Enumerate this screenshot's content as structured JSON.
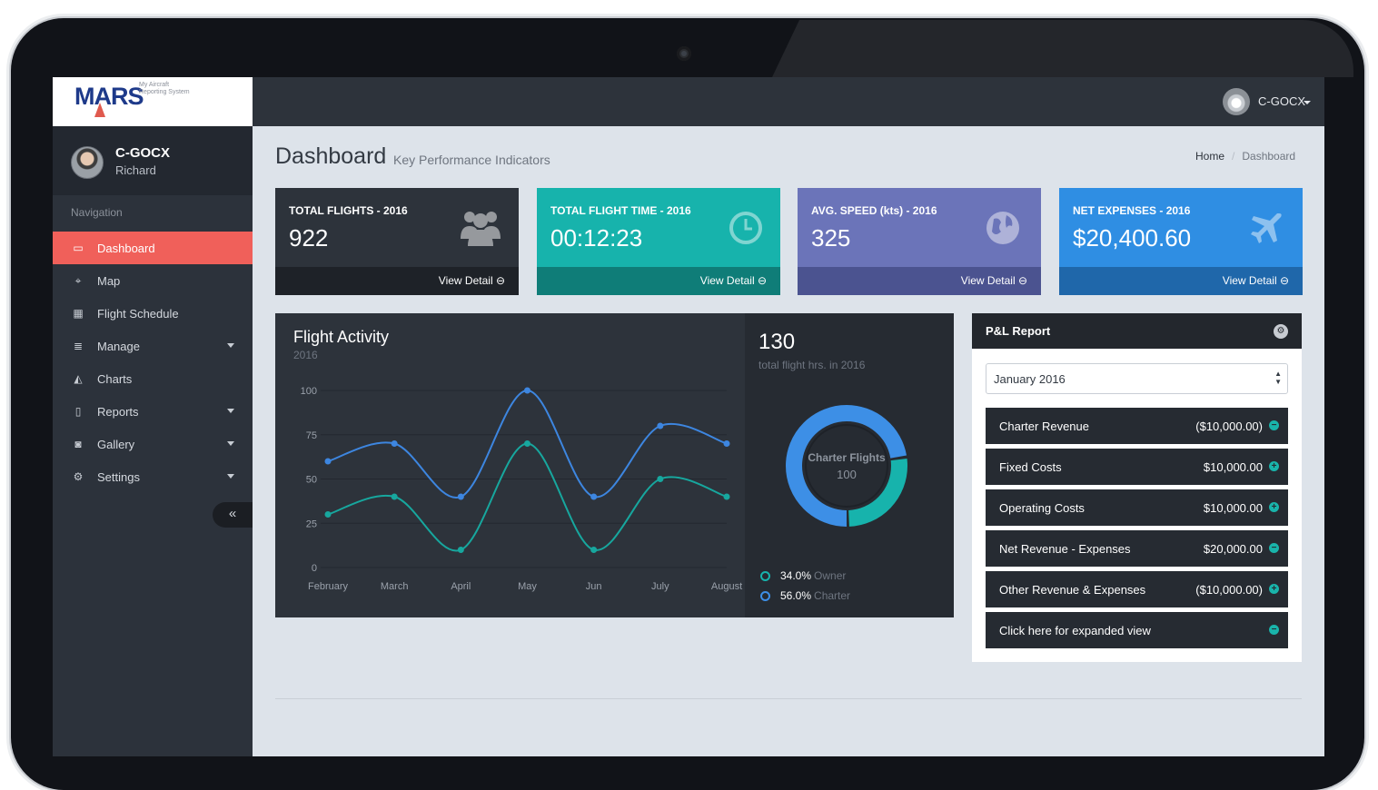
{
  "brand": {
    "logo_text": "MARS",
    "logo_tagline": "My Aircraft Reporting System"
  },
  "user": {
    "name": "C-GOCX",
    "subtitle": "Richard"
  },
  "topbar": {
    "user_label": "C-GOCX"
  },
  "sidebar": {
    "header": "Navigation",
    "items": [
      {
        "label": "Dashboard",
        "icon": "laptop-icon",
        "active": true,
        "has_caret": false
      },
      {
        "label": "Map",
        "icon": "map-marker-icon",
        "active": false,
        "has_caret": false
      },
      {
        "label": "Flight Schedule",
        "icon": "calendar-icon",
        "active": false,
        "has_caret": false
      },
      {
        "label": "Manage",
        "icon": "database-icon",
        "active": false,
        "has_caret": true
      },
      {
        "label": "Charts",
        "icon": "area-chart-icon",
        "active": false,
        "has_caret": false
      },
      {
        "label": "Reports",
        "icon": "file-icon",
        "active": false,
        "has_caret": true
      },
      {
        "label": "Gallery",
        "icon": "camera-icon",
        "active": false,
        "has_caret": true
      },
      {
        "label": "Settings",
        "icon": "gears-icon",
        "active": false,
        "has_caret": true
      }
    ],
    "collapse_label": "«"
  },
  "header": {
    "title": "Dashboard",
    "subtitle": "Key Performance Indicators"
  },
  "breadcrumb": {
    "home": "Home",
    "separator": "/",
    "current": "Dashboard"
  },
  "stats": [
    {
      "label": "TOTAL FLIGHTS - 2016",
      "value": "922",
      "link": "View Detail",
      "icon": "users-icon"
    },
    {
      "label": "TOTAL FLIGHT TIME - 2016",
      "value": "00:12:23",
      "link": "View Detail",
      "icon": "clock-icon"
    },
    {
      "label": "AVG. SPEED (kts) - 2016",
      "value": "325",
      "link": "View Detail",
      "icon": "globe-icon"
    },
    {
      "label": "NET EXPENSES - 2016",
      "value": "$20,400.60",
      "link": "View Detail",
      "icon": "plane-icon"
    }
  ],
  "activity": {
    "title": "Flight Activity",
    "year": "2016",
    "total": "130",
    "total_label": "total flight hrs. in 2016",
    "donut_label": "Charter Flights",
    "donut_value": "100",
    "legend": [
      {
        "pct": "34.0%",
        "name": "Owner",
        "color": "#17b3ac"
      },
      {
        "pct": "56.0%",
        "name": "Charter",
        "color": "#3d8fe6"
      }
    ]
  },
  "chart_data": [
    {
      "type": "line",
      "title": "Flight Activity",
      "subtitle": "2016",
      "categories": [
        "February",
        "March",
        "April",
        "May",
        "Jun",
        "July",
        "August"
      ],
      "y_ticks": [
        "0",
        "25",
        "50",
        "75",
        "100"
      ],
      "ylim": [
        0,
        100
      ],
      "grid": true,
      "series": [
        {
          "values": [
            60,
            70,
            40,
            100,
            40,
            80,
            70
          ],
          "color": "#3d86e0"
        },
        {
          "values": [
            30,
            40,
            10,
            70,
            10,
            50,
            40
          ],
          "color": "#17a79e"
        }
      ]
    },
    {
      "type": "pie",
      "title": "Charter Flights",
      "center_value": "100",
      "slices": [
        {
          "value": 73,
          "color": "#3d8fe6"
        },
        {
          "value": 27,
          "color": "#17b3ac"
        }
      ]
    }
  ],
  "pl": {
    "title": "P&L Report",
    "selected_month": "January 2016",
    "rows": [
      {
        "name": "Charter Revenue",
        "amount": "($10,000.00)",
        "badge": "minus"
      },
      {
        "name": "Fixed Costs",
        "amount": "$10,000.00",
        "badge": "plus"
      },
      {
        "name": "Operating Costs",
        "amount": "$10,000.00",
        "badge": "plus"
      },
      {
        "name": "Net Revenue - Expenses",
        "amount": "$20,000.00",
        "badge": "minus"
      },
      {
        "name": "Other Revenue & Expenses",
        "amount": "($10,000.00)",
        "badge": "plus"
      },
      {
        "name": "Click here for expanded view",
        "amount": "",
        "badge": "minus"
      }
    ]
  },
  "colors": {
    "accent_red": "#f0605a",
    "teal": "#17b3ac",
    "purple": "#6b74b9",
    "blue": "#2f8ee3",
    "dark": "#2d333b"
  }
}
